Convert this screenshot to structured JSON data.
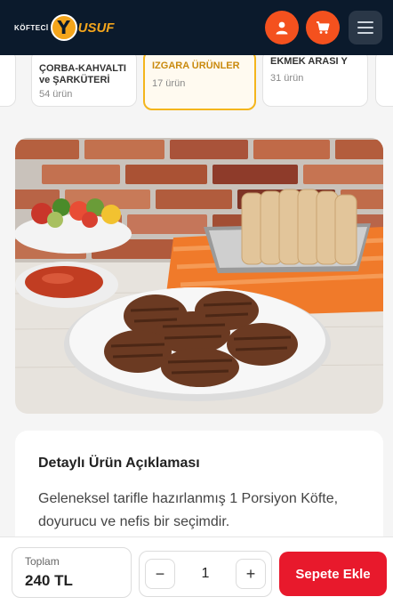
{
  "header": {
    "logo_small": "KÖFTECİ",
    "logo_initial": "Y",
    "logo_rest": "USUF",
    "icons": [
      "user-icon",
      "cart-icon",
      "hamburger-menu-icon"
    ],
    "accent_color": "#f4511e"
  },
  "categories": [
    {
      "name": "ÇORBA-KAHVALTI ve ŞARKÜTERİ",
      "count": "54 ürün",
      "active": false
    },
    {
      "name": "IZGARA ÜRÜNLER",
      "count": "17 ürün",
      "active": true
    },
    {
      "name": "EKMEK ARASI Y",
      "count": "31 ürün",
      "active": false
    }
  ],
  "description": {
    "title": "Detaylı Ürün Açıklaması",
    "text": "Geleneksel tarifle hazırlanmış 1 Porsiyon Köfte, doyurucu ve nefis bir seçimdir."
  },
  "order": {
    "total_label": "Toplam",
    "total_amount": "240 TL",
    "quantity": "1",
    "minus_label": "−",
    "plus_label": "+",
    "add_button": "Sepete Ekle",
    "button_color": "#e8192c"
  }
}
